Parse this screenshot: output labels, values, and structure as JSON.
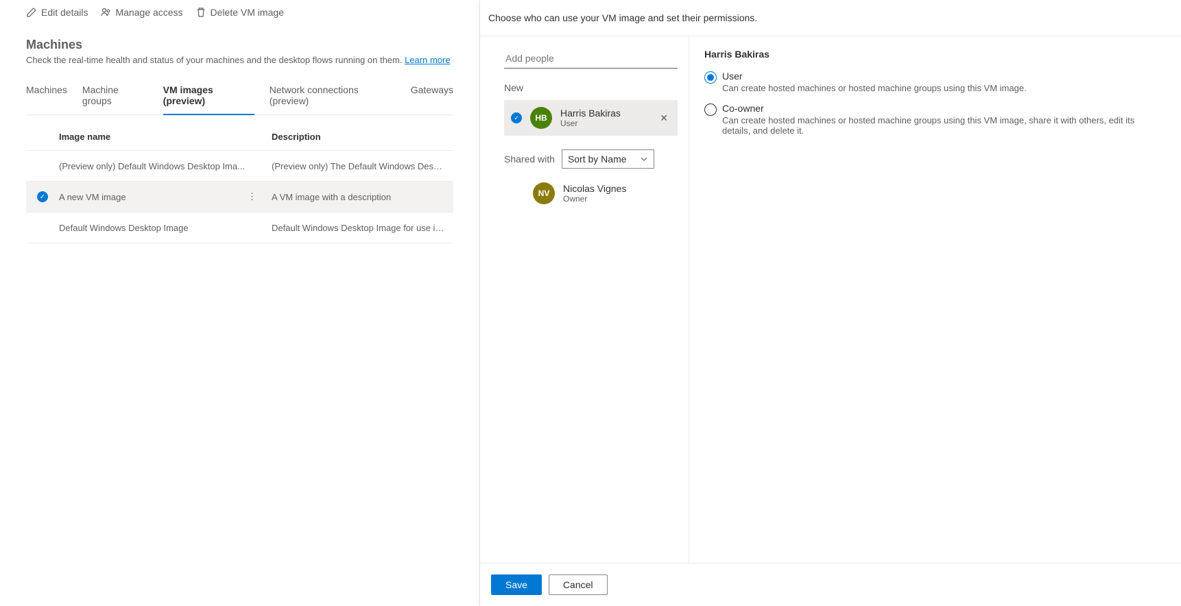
{
  "command_bar": {
    "edit_label": "Edit details",
    "manage_label": "Manage access",
    "delete_label": "Delete VM image"
  },
  "page": {
    "title": "Machines",
    "subtitle_text": "Check the real-time health and status of your machines and the desktop flows running on them. ",
    "learn_more": "Learn more"
  },
  "tabs": [
    {
      "label": "Machines",
      "active": false
    },
    {
      "label": "Machine groups",
      "active": false
    },
    {
      "label": "VM images (preview)",
      "active": true
    },
    {
      "label": "Network connections (preview)",
      "active": false
    },
    {
      "label": "Gateways",
      "active": false
    }
  ],
  "table": {
    "columns": {
      "name": "Image name",
      "desc": "Description"
    },
    "rows": [
      {
        "selected": false,
        "name": "(Preview only) Default Windows Desktop Ima...",
        "desc": "(Preview only) The Default Windows Desktop Image for use i..."
      },
      {
        "selected": true,
        "name": "A new VM image",
        "desc": "A VM image with a description"
      },
      {
        "selected": false,
        "name": "Default Windows Desktop Image",
        "desc": "Default Windows Desktop Image for use in Microsoft Deskto..."
      }
    ]
  },
  "panel": {
    "header": "Choose who can use your VM image and set their permissions.",
    "add_placeholder": "Add people",
    "new_label": "New",
    "new_people": [
      {
        "initials": "HB",
        "name": "Harris Bakiras",
        "role": "User",
        "avatarColor": "green",
        "selected": true
      }
    ],
    "shared_label": "Shared with",
    "sort_label": "Sort by Name",
    "shared_people": [
      {
        "initials": "NV",
        "name": "Nicolas Vignes",
        "role": "Owner",
        "avatarColor": "olive"
      }
    ],
    "right": {
      "title": "Harris Bakiras",
      "options": [
        {
          "label": "User",
          "desc": "Can create hosted machines or hosted machine groups using this VM image.",
          "checked": true
        },
        {
          "label": "Co-owner",
          "desc": "Can create hosted machines or hosted machine groups using this VM image, share it with others, edit its details, and delete it.",
          "checked": false
        }
      ]
    },
    "footer": {
      "save": "Save",
      "cancel": "Cancel"
    }
  }
}
